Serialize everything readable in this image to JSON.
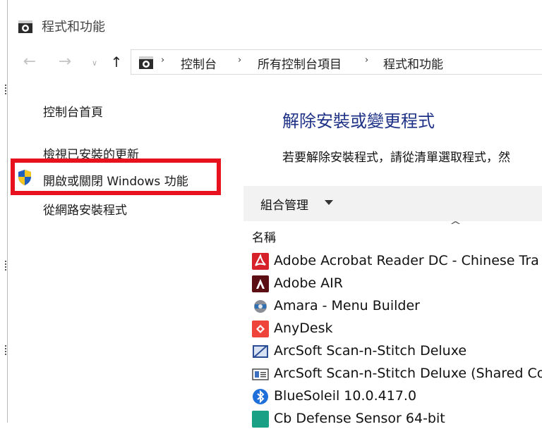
{
  "window": {
    "title": "程式和功能"
  },
  "nav": {
    "back_glyph": "←",
    "forward_glyph": "→",
    "recent_glyph": "∨",
    "up_glyph": "↑",
    "breadcrumb": [
      "控制台",
      "所有控制台項目",
      "程式和功能"
    ],
    "sep": "›"
  },
  "left_pane": {
    "home": "控制台首頁",
    "updates": "檢視已安裝的更新",
    "features": "開啟或關閉 Windows 功能",
    "network_install": "從網路安裝程式"
  },
  "main": {
    "title": "解除安裝或變更程式",
    "description": "若要解除安裝程式，請從清單選取程式，然",
    "organize_label": "組合管理",
    "sort_caret": "^",
    "column_name": "名稱"
  },
  "programs": [
    {
      "name": "Adobe Acrobat Reader DC - Chinese Tra",
      "icon": "acrobat-icon"
    },
    {
      "name": "Adobe AIR",
      "icon": "adobe-air-icon"
    },
    {
      "name": "Amara - Menu Builder",
      "icon": "amara-icon"
    },
    {
      "name": "AnyDesk",
      "icon": "anydesk-icon"
    },
    {
      "name": "ArcSoft Scan-n-Stitch Deluxe",
      "icon": "arcsoft-icon"
    },
    {
      "name": "ArcSoft Scan-n-Stitch Deluxe (Shared Co",
      "icon": "arcsoft-shared-icon"
    },
    {
      "name": "BlueSoleil 10.0.417.0",
      "icon": "bluetooth-icon"
    },
    {
      "name": "Cb Defense Sensor 64-bit",
      "icon": "cb-defense-icon"
    }
  ],
  "colors": {
    "highlight": "#e8121e",
    "title_blue": "#1e3287",
    "toolbar_bg": "#f2f2f2"
  }
}
